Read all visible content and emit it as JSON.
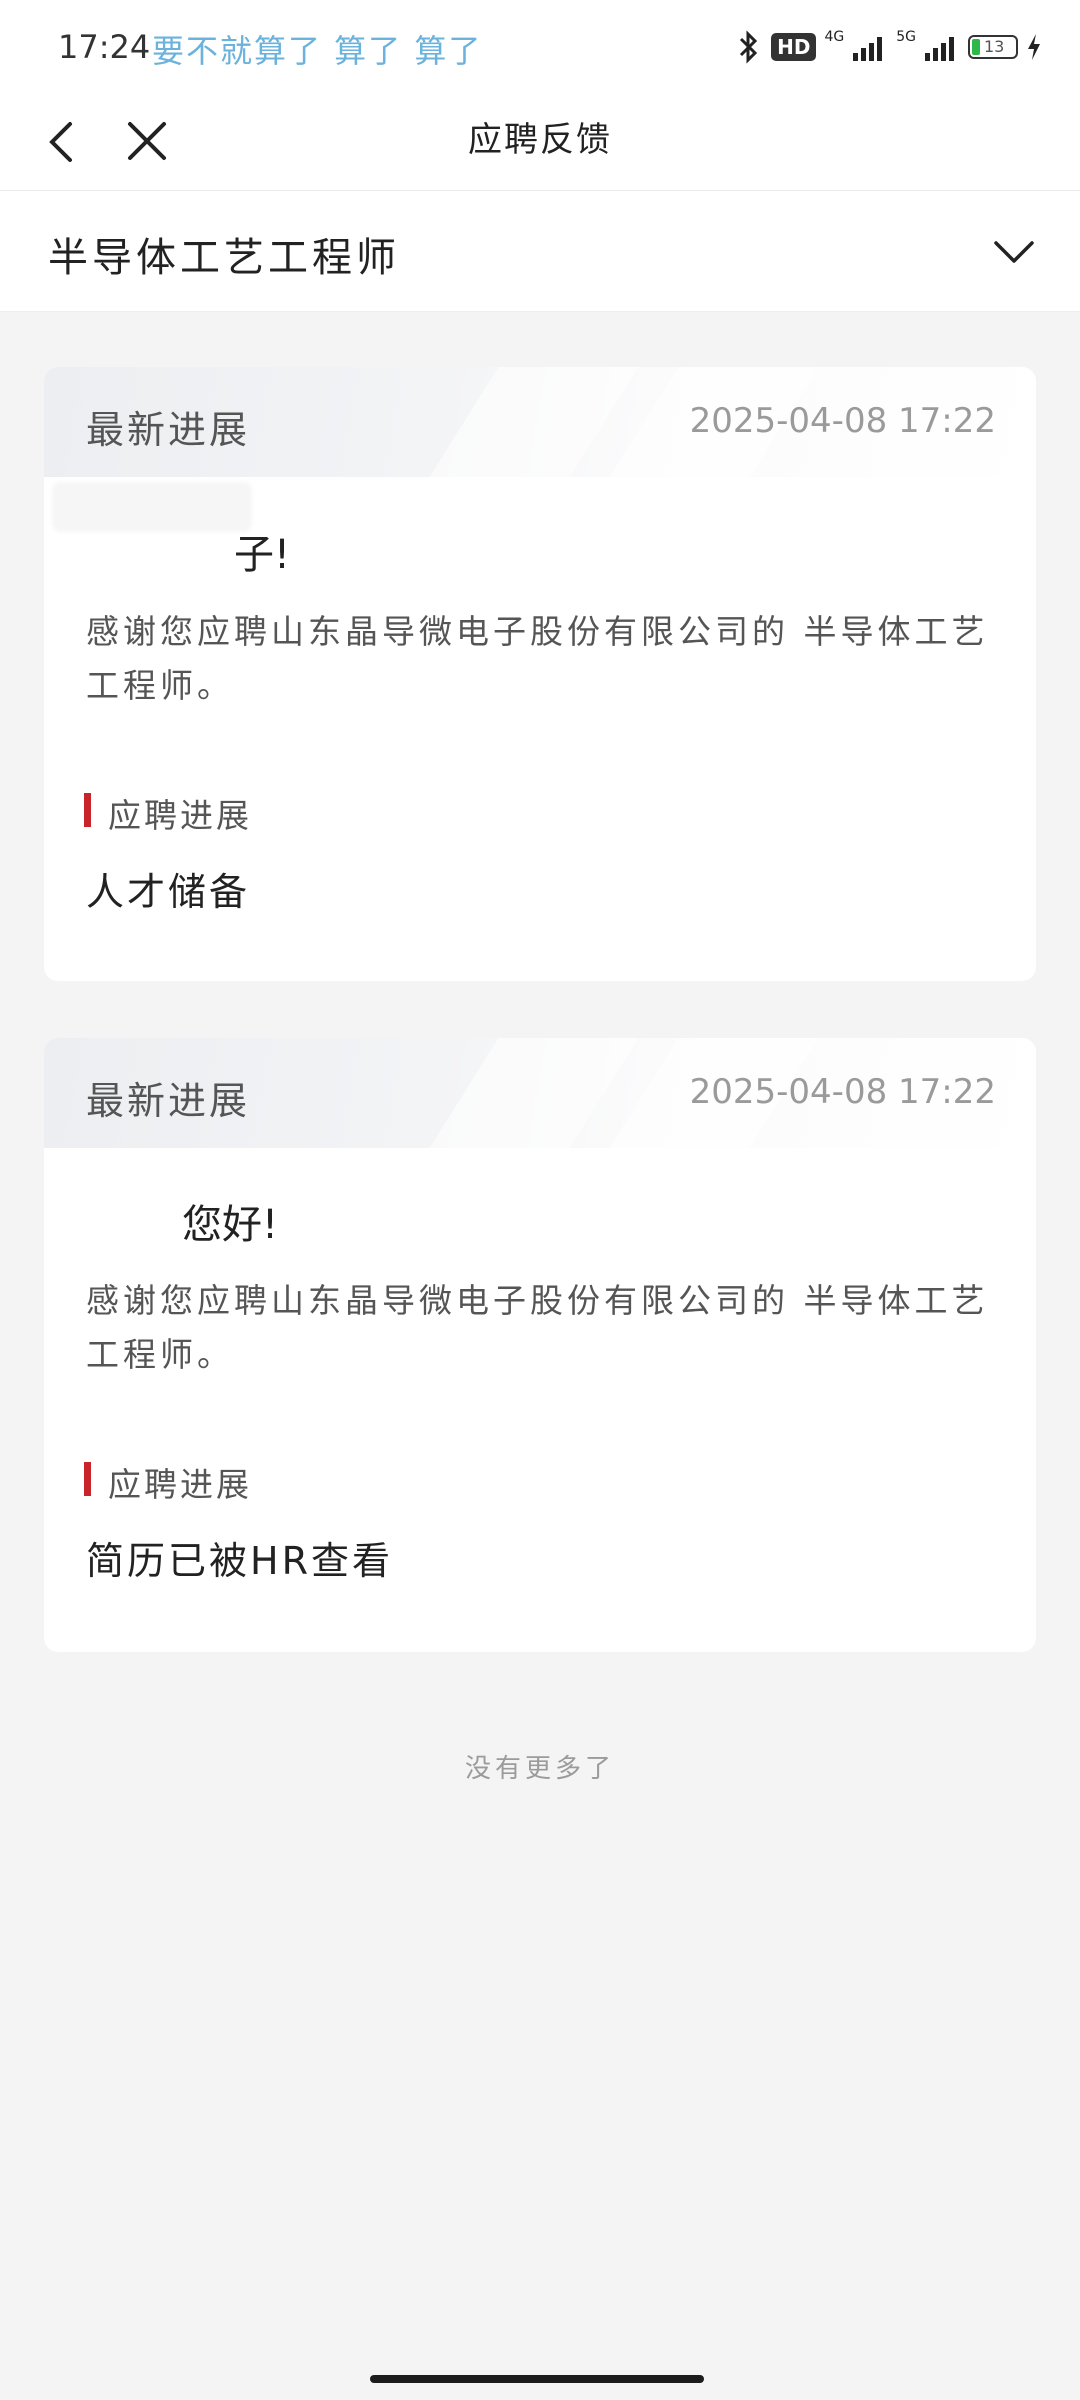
{
  "status_bar": {
    "time": "17:24",
    "notes": "要不就算了  算了  算了",
    "hd_label": "HD",
    "net1": "4G",
    "net2": "5G",
    "battery": "13"
  },
  "nav": {
    "title": "应聘反馈"
  },
  "job_selector": {
    "title": "半导体工艺工程师"
  },
  "cards": [
    {
      "header": "最新进展",
      "date": "2025-04-08  17:22",
      "greeting": "子!",
      "message": "感谢您应聘山东晶导微电子股份有限公司的 半导体工艺工程师。",
      "progress_label": "应聘进展",
      "progress_value": "人才储备"
    },
    {
      "header": "最新进展",
      "date": "2025-04-08  17:22",
      "greeting": "您好!",
      "message": "感谢您应聘山东晶导微电子股份有限公司的 半导体工艺工程师。",
      "progress_label": "应聘进展",
      "progress_value": "简历已被HR查看"
    }
  ],
  "footer": {
    "no_more": "没有更多了"
  },
  "colors": {
    "accent_red": "#c8252b",
    "status_note_blue": "#6bb2dc",
    "page_bg": "#f4f4f4"
  }
}
